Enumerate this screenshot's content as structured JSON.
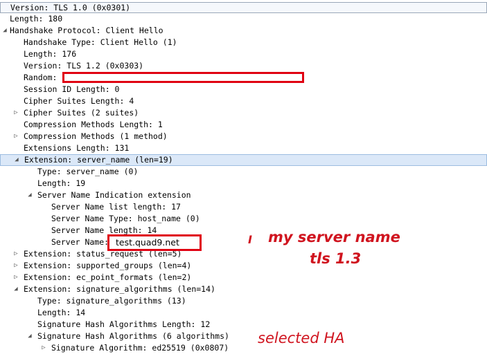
{
  "tree": [
    {
      "level": 0,
      "toggle": "",
      "text": "Version: TLS 1.0 (0x0301)",
      "style": "first"
    },
    {
      "level": 0,
      "toggle": "",
      "text": "Length: 180"
    },
    {
      "level": 0,
      "toggle": "expanded",
      "text": "Handshake Protocol: Client Hello"
    },
    {
      "level": 1,
      "toggle": "",
      "text": "Handshake Type: Client Hello (1)"
    },
    {
      "level": 1,
      "toggle": "",
      "text": "Length: 176"
    },
    {
      "level": 1,
      "toggle": "",
      "text": "Version: TLS 1.2 (0x0303)"
    },
    {
      "level": 1,
      "toggle": "",
      "text": "Random:"
    },
    {
      "level": 1,
      "toggle": "",
      "text": "Session ID Length: 0"
    },
    {
      "level": 1,
      "toggle": "",
      "text": "Cipher Suites Length: 4"
    },
    {
      "level": 1,
      "toggle": "collapsed",
      "text": "Cipher Suites (2 suites)"
    },
    {
      "level": 1,
      "toggle": "",
      "text": "Compression Methods Length: 1"
    },
    {
      "level": 1,
      "toggle": "collapsed",
      "text": "Compression Methods (1 method)"
    },
    {
      "level": 1,
      "toggle": "",
      "text": "Extensions Length: 131"
    },
    {
      "level": 1,
      "toggle": "expanded",
      "text": "Extension: server_name (len=19)",
      "style": "sel"
    },
    {
      "level": 2,
      "toggle": "",
      "text": "Type: server_name (0)"
    },
    {
      "level": 2,
      "toggle": "",
      "text": "Length: 19"
    },
    {
      "level": 2,
      "toggle": "expanded",
      "text": "Server Name Indication extension"
    },
    {
      "level": 3,
      "toggle": "",
      "text": "Server Name list length: 17"
    },
    {
      "level": 3,
      "toggle": "",
      "text": "Server Name Type: host_name (0)"
    },
    {
      "level": 3,
      "toggle": "",
      "text": "Server Name length: 14"
    },
    {
      "level": 3,
      "toggle": "",
      "text": "Server Name:"
    },
    {
      "level": 1,
      "toggle": "collapsed",
      "text": "Extension: status_request (len=5)"
    },
    {
      "level": 1,
      "toggle": "collapsed",
      "text": "Extension: supported_groups (len=4)"
    },
    {
      "level": 1,
      "toggle": "collapsed",
      "text": "Extension: ec_point_formats (len=2)"
    },
    {
      "level": 1,
      "toggle": "expanded",
      "text": "Extension: signature_algorithms (len=14)"
    },
    {
      "level": 2,
      "toggle": "",
      "text": "Type: signature_algorithms (13)"
    },
    {
      "level": 2,
      "toggle": "",
      "text": "Length: 14"
    },
    {
      "level": 2,
      "toggle": "",
      "text": "Signature Hash Algorithms Length: 12"
    },
    {
      "level": 2,
      "toggle": "expanded",
      "text": "Signature Hash Algorithms (6 algorithms)"
    },
    {
      "level": 3,
      "toggle": "collapsed",
      "text": "Signature Algorithm: ed25519 (0x0807)"
    }
  ],
  "server_name_value": "test.quad9.net",
  "annotations": {
    "cursor": "I",
    "line1": "my server name",
    "line2": "tls 1.3",
    "selected": "selected HA"
  },
  "colors": {
    "annotation": "#d0141f",
    "highlight_box": "#e00012",
    "selected_row": "#dbe8f8"
  },
  "icons": {
    "expanded": "triangle-expanded-icon",
    "collapsed": "triangle-collapsed-icon"
  }
}
